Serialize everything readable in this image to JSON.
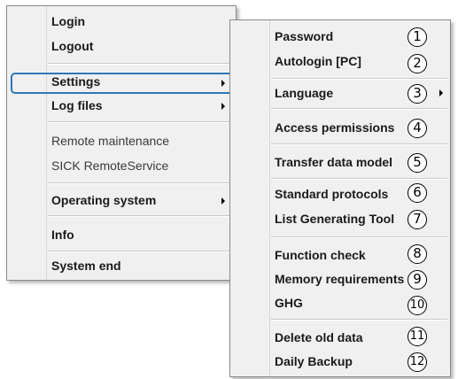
{
  "main_menu": {
    "login": "Login",
    "logout": "Logout",
    "settings": "Settings",
    "log_files": "Log files",
    "remote_maintenance": "Remote maintenance",
    "sick_remoteservice": "SICK RemoteService",
    "operating_system": "Operating system",
    "info": "Info",
    "system_end": "System end"
  },
  "settings_submenu": {
    "items": [
      {
        "label": "Password",
        "callout": "1"
      },
      {
        "label": "Autologin [PC]",
        "callout": "2"
      },
      {
        "label": "Language",
        "callout": "3"
      },
      {
        "label": "Access permissions",
        "callout": "4"
      },
      {
        "label": "Transfer data model",
        "callout": "5"
      },
      {
        "label": "Standard protocols",
        "callout": "6"
      },
      {
        "label": "List Generating Tool",
        "callout": "7"
      },
      {
        "label": "Function check",
        "callout": "8"
      },
      {
        "label": "Memory requirements",
        "callout": "9"
      },
      {
        "label": "GHG",
        "callout": "10"
      },
      {
        "label": "Delete old data",
        "callout": "11"
      },
      {
        "label": "Daily Backup",
        "callout": "12"
      }
    ]
  },
  "colors": {
    "menu_background": "#f0f0f0",
    "highlight_border": "#2d78b7"
  },
  "icons": {
    "submenu_arrow": "chevron-right-icon"
  }
}
